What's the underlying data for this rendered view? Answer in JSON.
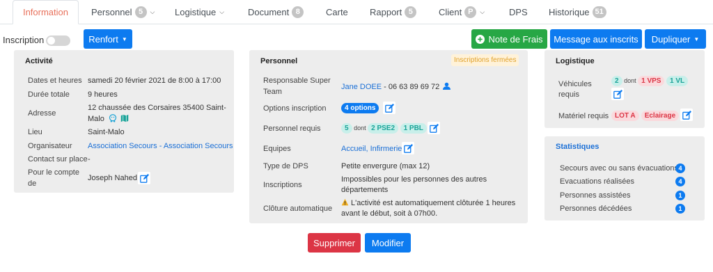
{
  "tabs": [
    {
      "label": "Information"
    },
    {
      "label": "Personnel",
      "badge": "5"
    },
    {
      "label": "Logistique"
    },
    {
      "label": "Document",
      "badge": "8"
    },
    {
      "label": "Carte"
    },
    {
      "label": "Rapport",
      "badge": "5"
    },
    {
      "label": "Client",
      "badge": "P"
    },
    {
      "label": "DPS"
    },
    {
      "label": "Historique",
      "badge": "51"
    }
  ],
  "toolbar": {
    "inscription_label": "Inscription",
    "renfort_label": "Renfort",
    "note_frais_label": "Note de Frais",
    "message_label": "Message aux inscrits",
    "dupliquer_label": "Dupliquer"
  },
  "activite": {
    "title": "Activité",
    "dates_label": "Dates et heures",
    "dates_value": "samedi 20 février 2021 de 8:00 à 17:00",
    "duree_label": "Durée totale",
    "duree_value": "9 heures",
    "adresse_label": "Adresse",
    "adresse_line1": "12 chaussée des Corsaires 35400 Saint-",
    "adresse_line2": "Malo",
    "lieu_label": "Lieu",
    "lieu_value": "Saint-Malo",
    "organisateur_label": "Organisateur",
    "organisateur_value": "Association Secours - Association Secours",
    "contact_label": "Contact sur place",
    "contact_value": "-",
    "compte_label_line1": "Pour le compte",
    "compte_label_line2": "de",
    "compte_value": "Joseph Nahed"
  },
  "personnel": {
    "title": "Personnel",
    "status_badge": "Inscriptions fermées",
    "responsable_label_line1": "Responsable Super",
    "responsable_label_line2": "Team",
    "responsable_name": "Jane DOEE",
    "responsable_phone": " - 06 63 89 69 72",
    "options_label": "Options inscription",
    "options_value": "4 options",
    "requis_label": "Personnel requis",
    "requis_count": "5",
    "requis_dont": "dont",
    "requis_pse2": "2 PSE2",
    "requis_pbl": "1 PBL",
    "equipes_label": "Equipes",
    "equipes_value": "Accueil, Infirmerie",
    "type_label": "Type de DPS",
    "type_value": "Petite envergure (max 12)",
    "inscriptions_label": "Inscriptions",
    "inscriptions_line1": "Impossibles pour les personnes des autres",
    "inscriptions_line2": "départements",
    "cloture_label": "Clôture automatique",
    "cloture_line1": "L'activité est automatiquement clôturée 1 heures",
    "cloture_line2": "avant le début, soit à 07h00."
  },
  "logistique": {
    "title": "Logistique",
    "vehicules_label_line1": "Véhicules",
    "vehicules_label_line2": "requis",
    "veh_count": "2",
    "veh_dont": "dont",
    "veh_vps": "1 VPS",
    "veh_vl": "1 VL",
    "materiel_label": "Matériel requis",
    "materiel_lota": "LOT A",
    "materiel_eclairage": "Eclairage"
  },
  "statistiques": {
    "title": "Statistiques",
    "items": [
      {
        "label": "Secours avec ou sans évacuations",
        "count": "4"
      },
      {
        "label": "Evacuations réalisées",
        "count": "4"
      },
      {
        "label": "Personnes assistées",
        "count": "1"
      },
      {
        "label": "Personnes décédées",
        "count": "1"
      }
    ]
  },
  "actions": {
    "supprimer_label": "Supprimer",
    "modifier_label": "Modifier"
  },
  "colors": {
    "primary": "#0d7bf0",
    "success": "#27a745",
    "danger": "#dc3545",
    "active_tab": "#e8705a",
    "teal": "#1aa398"
  }
}
